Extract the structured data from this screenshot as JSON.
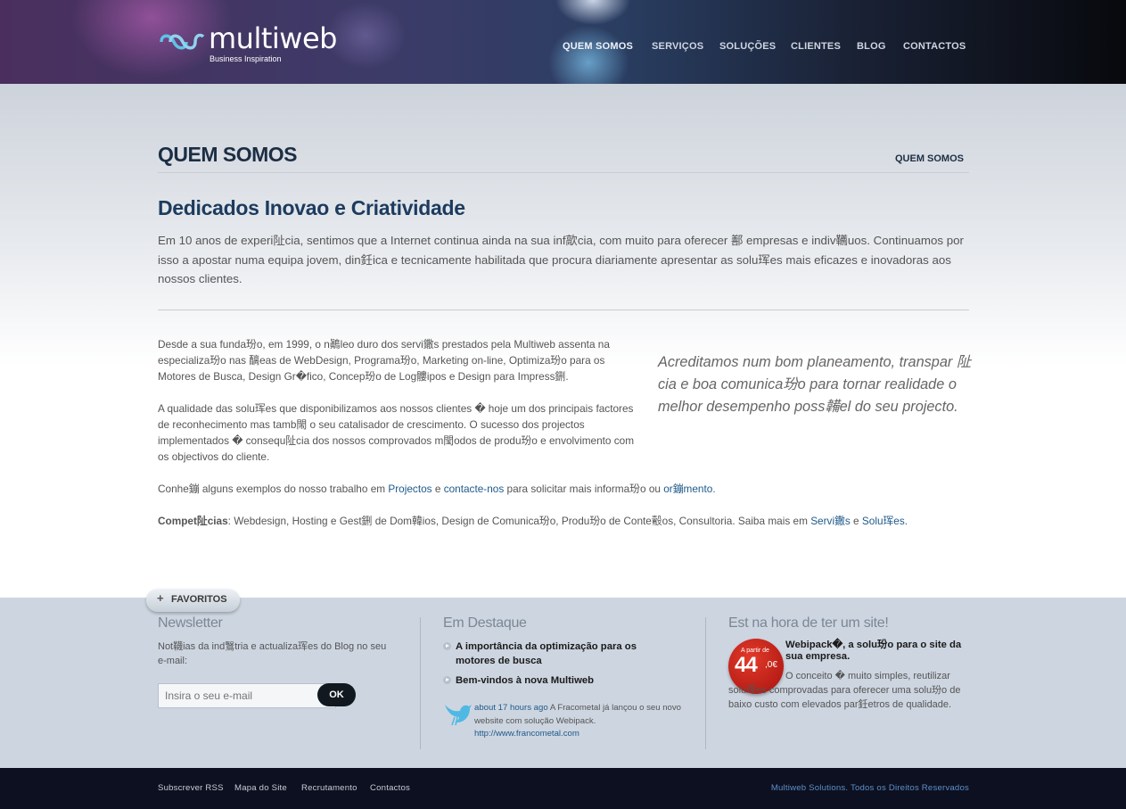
{
  "header": {
    "logo_text": "multiweb",
    "logo_tagline": "Business Inspiration",
    "nav": [
      "QUEM SOMOS",
      "SERVIÇOS",
      "SOLUÇÕES",
      "CLIENTES",
      "BLOG",
      "CONTACTOS"
    ]
  },
  "page": {
    "title": "QUEM SOMOS",
    "breadcrumb": "QUEM SOMOS",
    "subtitle": "Dedicados  Inovao e Criatividade",
    "intro": "Em 10 anos de experi阯cia, sentimos que a Internet continua ainda na sua inf歊cia, com muito para oferecer 鄯 empresas e indiv韉uos. Continuamos por isso a apostar numa equipa jovem, din鈓ica e tecnicamente habilitada que procura diariamente apresentar as solu珲es mais eficazes e inovadoras aos nossos clientes.",
    "para1": "Desde a sua funda玢o, em 1999, o n鷆leo duro dos servi鏾s prestados pela Multiweb assenta na especializa玢o nas 醨eas de WebDesign, Programa玢o, Marketing on-line, Optimiza玢o para os Motores de Busca, Design Gr�fico, Concep玢o de Log髏ipos e Design para Impress鉶.",
    "para2": "A qualidade das solu珲es que disponibilizamos aos nossos clientes � hoje um dos principais factores de reconhecimento mas tamb閙 o seu catalisador de crescimento. O sucesso dos projectos implementados � consequ阯cia dos nossos comprovados m閠odos de produ玢o e envolvimento com os objectivos do cliente.",
    "para3_prefix": "Conhe鏰 alguns exemplos do nosso trabalho em ",
    "para3_link1": "Projectos",
    "para3_and": " e ",
    "para3_link2": "contacte-nos",
    "para3_mid": " para solicitar mais informa玢o ou ",
    "para3_link3": "or鏰mento",
    "para3_end": ".",
    "para4_label": "Compet阯cias",
    "para4_text": ": Webdesign, Hosting e Gest鉶 de Dom韓ios, Design de Comunica玢o, Produ玢o de Conte鷇os, Consultoria. Saiba mais em ",
    "para4_link1": "Servi鏾s",
    "para4_and": " e ",
    "para4_link2": "Solu珲es",
    "para4_end": ".",
    "quote": "Acreditamos num bom planeamento, transpar 阯cia e boa comunica玢o para tornar realidade o melhor desempenho poss韛el do seu projecto."
  },
  "footer": {
    "favoritos_label": "FAVORITOS",
    "newsletter": {
      "title": "Newsletter",
      "desc": "Not韈ias da ind鷖tria e actualiza珲es do Blog no seu e-mail:",
      "placeholder": "Insira o seu e-mail",
      "button": "OK"
    },
    "destaque": {
      "title": "Em Destaque",
      "items": [
        "A importância da optimização para os motores de busca",
        "Bem-vindos à nova Multiweb"
      ],
      "tweet_time": "about 17 hours ago",
      "tweet_text": " A Fracometal já lançou o seu novo website com solução Webipack.",
      "tweet_url": "http://www.francometal.com"
    },
    "site": {
      "title": "Est na hora de ter um site!",
      "badge_small": "A partir de",
      "badge_price": "44",
      "badge_cents": ",0€",
      "headline": "Webipack�, a solu玢o para o site da sua empresa.",
      "desc": "O conceito � muito simples, reutilizar solu珲es comprovadas para oferecer uma solu玢o de baixo custo com elevados par鈓etros de qualidade."
    }
  },
  "bottom": {
    "links": [
      "Subscrever RSS",
      "Mapa do Site",
      "Recrutamento",
      "Contactos"
    ],
    "copyright": "Multiweb Solutions. Todos os Direitos Reservados"
  },
  "colors": {
    "brand_dark": "#1c2e44",
    "link": "#1f5a8a",
    "badge_red": "#c8201a",
    "bottom_bar": "#0c1020"
  }
}
